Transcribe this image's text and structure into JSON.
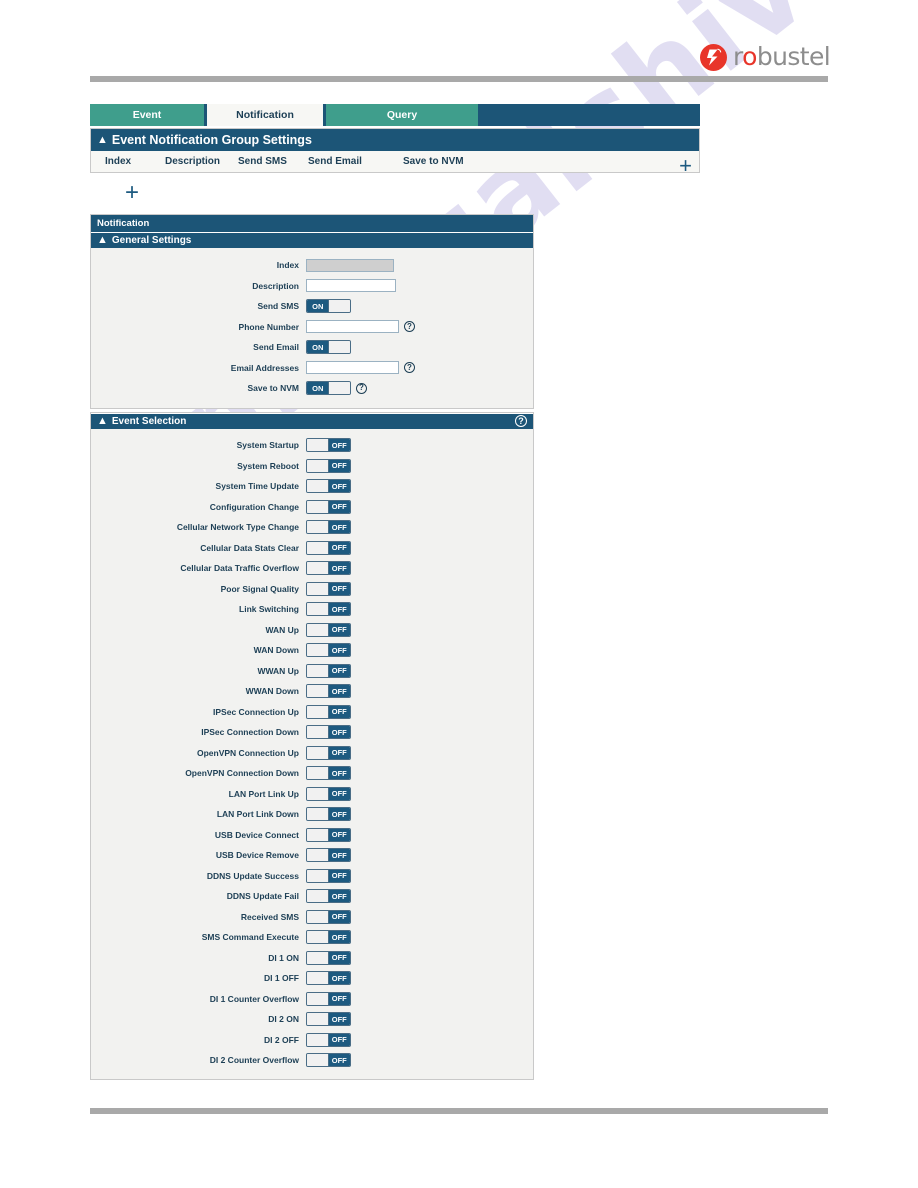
{
  "brand": {
    "name": "robustel",
    "logo_icon": "robustel-logo-icon"
  },
  "tabs": [
    {
      "label": "Event",
      "active": false
    },
    {
      "label": "Notification",
      "active": true
    },
    {
      "label": "Query",
      "active": false
    }
  ],
  "group_settings": {
    "title": "Event Notification Group Settings",
    "collapse_icon": "chevron-up-icon",
    "add_icon": "plus-icon",
    "columns": [
      "Index",
      "Description",
      "Send SMS",
      "Send Email",
      "Save to NVM"
    ]
  },
  "standalone_add": {
    "icon": "plus-icon"
  },
  "notification_panel": {
    "title": "Notification",
    "general": {
      "title": "General Settings",
      "collapse_icon": "chevron-up-icon",
      "fields": [
        {
          "label": "Index",
          "type": "text",
          "value": "",
          "disabled": true,
          "help": false
        },
        {
          "label": "Description",
          "type": "text",
          "value": "",
          "disabled": false,
          "help": false
        },
        {
          "label": "Send SMS",
          "type": "toggle",
          "state": "ON",
          "help": false
        },
        {
          "label": "Phone Number",
          "type": "text",
          "value": "",
          "disabled": false,
          "help": true
        },
        {
          "label": "Send Email",
          "type": "toggle",
          "state": "ON",
          "help": false
        },
        {
          "label": "Email Addresses",
          "type": "text",
          "value": "",
          "disabled": false,
          "help": true
        },
        {
          "label": "Save to NVM",
          "type": "toggle",
          "state": "ON",
          "help": true
        }
      ]
    }
  },
  "event_selection": {
    "title": "Event Selection",
    "collapse_icon": "chevron-up-icon",
    "help_icon": "question-mark-icon",
    "events": [
      {
        "label": "System Startup",
        "state": "OFF"
      },
      {
        "label": "System Reboot",
        "state": "OFF"
      },
      {
        "label": "System Time Update",
        "state": "OFF"
      },
      {
        "label": "Configuration Change",
        "state": "OFF"
      },
      {
        "label": "Cellular Network Type Change",
        "state": "OFF"
      },
      {
        "label": "Cellular Data Stats Clear",
        "state": "OFF"
      },
      {
        "label": "Cellular Data Traffic Overflow",
        "state": "OFF"
      },
      {
        "label": "Poor Signal Quality",
        "state": "OFF"
      },
      {
        "label": "Link Switching",
        "state": "OFF"
      },
      {
        "label": "WAN Up",
        "state": "OFF"
      },
      {
        "label": "WAN Down",
        "state": "OFF"
      },
      {
        "label": "WWAN Up",
        "state": "OFF"
      },
      {
        "label": "WWAN Down",
        "state": "OFF"
      },
      {
        "label": "IPSec Connection Up",
        "state": "OFF"
      },
      {
        "label": "IPSec Connection Down",
        "state": "OFF"
      },
      {
        "label": "OpenVPN Connection Up",
        "state": "OFF"
      },
      {
        "label": "OpenVPN Connection Down",
        "state": "OFF"
      },
      {
        "label": "LAN Port Link Up",
        "state": "OFF"
      },
      {
        "label": "LAN Port Link Down",
        "state": "OFF"
      },
      {
        "label": "USB Device Connect",
        "state": "OFF"
      },
      {
        "label": "USB Device Remove",
        "state": "OFF"
      },
      {
        "label": "DDNS Update Success",
        "state": "OFF"
      },
      {
        "label": "DDNS Update Fail",
        "state": "OFF"
      },
      {
        "label": "Received SMS",
        "state": "OFF"
      },
      {
        "label": "SMS Command Execute",
        "state": "OFF"
      },
      {
        "label": "DI 1 ON",
        "state": "OFF"
      },
      {
        "label": "DI 1 OFF",
        "state": "OFF"
      },
      {
        "label": "DI 1 Counter Overflow",
        "state": "OFF"
      },
      {
        "label": "DI 2 ON",
        "state": "OFF"
      },
      {
        "label": "DI 2 OFF",
        "state": "OFF"
      },
      {
        "label": "DI 2 Counter Overflow",
        "state": "OFF"
      }
    ]
  },
  "watermark": {
    "text": "manualshive.com"
  },
  "colors": {
    "header_blue": "#1c5577",
    "tab_teal": "#3f9e8c",
    "toggle_blue": "#1d5a80",
    "panel_bg": "#f2f2f0",
    "brand_red": "#e8352a",
    "rule_gray": "#a9a9a9"
  }
}
